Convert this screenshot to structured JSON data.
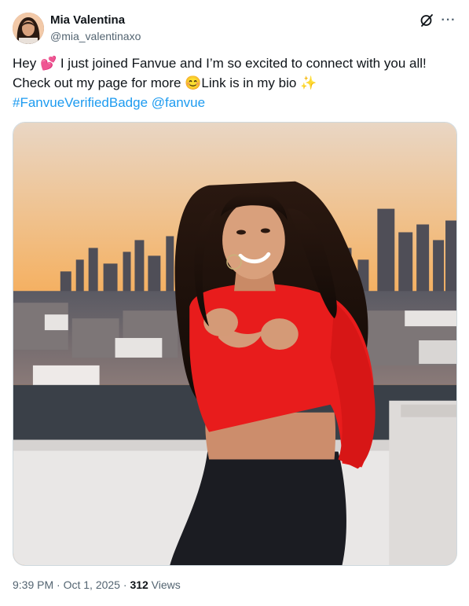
{
  "author": {
    "name": "Mia Valentina",
    "handle": "@mia_valentinaxo"
  },
  "header_icons": {
    "grok": "grok-icon",
    "more": "more-icon",
    "more_glyph": "···"
  },
  "post": {
    "line1_a": "Hey ",
    "emoji_heart": "💕",
    "line1_b": " I just joined Fanvue and I’m so excited to connect with you all!",
    "line2_a": "Check out my page for more ",
    "emoji_smile": "😊",
    "line2_b": "Link is in my bio ",
    "emoji_sparkles": "✨",
    "hashtag": "#FanvueVerifiedBadge",
    "mention": "@fanvue"
  },
  "meta": {
    "time": "9:39 PM",
    "sep1": " · ",
    "date": "Oct 1, 2025",
    "sep2": " · ",
    "views_count": "312",
    "views_label": " Views"
  },
  "colors": {
    "link": "#1d9bf0",
    "secondary_text": "#536471",
    "top_red": "#e81c1c"
  }
}
